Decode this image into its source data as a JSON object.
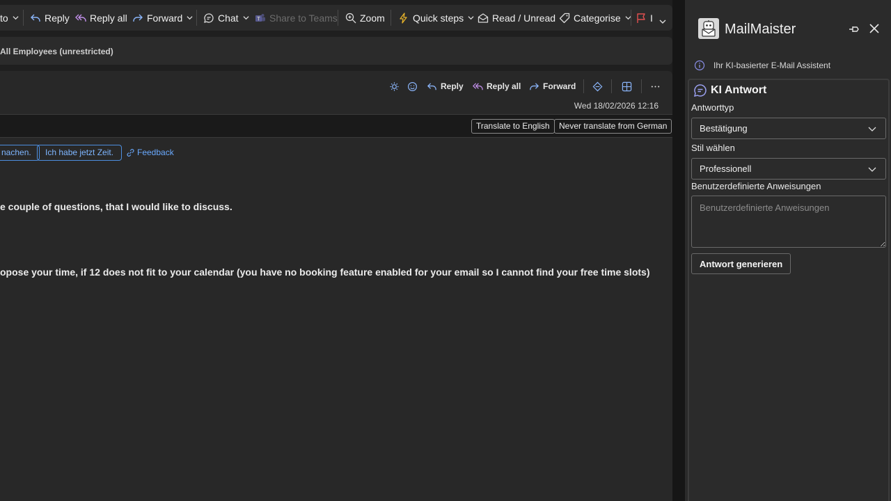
{
  "ribbon": {
    "move_label": "to",
    "reply": "Reply",
    "reply_all": "Reply all",
    "forward": "Forward",
    "chat": "Chat",
    "share_to_teams": "Share to Teams",
    "zoom": "Zoom",
    "quick_steps": "Quick steps",
    "read_unread": "Read / Unread",
    "categorise": "Categorise",
    "flag_label": "I"
  },
  "sensitivity": {
    "label": "All Employees (unrestricted)"
  },
  "message": {
    "toolbar": {
      "reply": "Reply",
      "reply_all": "Reply all",
      "forward": "Forward"
    },
    "date": "Wed 18/02/2026 12:16",
    "translate_button": "Translate to English",
    "never_translate_button": "Never translate from German",
    "suggested_replies": [
      "nachen.",
      "Ich habe jetzt Zeit."
    ],
    "feedback": "Feedback",
    "body": [
      "e couple of questions, that I would like to discuss.",
      "opose your time, if 12 does not fit to your calendar (you have no booking feature enabled for your email so I cannot find your free time slots)"
    ]
  },
  "addin": {
    "title": "MailMaister",
    "subtitle": "Ihr KI-basierter E-Mail Assistent",
    "section_title": "KI Antwort",
    "response_type_label": "Antworttyp",
    "response_type_value": "Bestätigung",
    "style_label": "Stil wählen",
    "style_value": "Professionell",
    "custom_label": "Benutzerdefinierte Anweisungen",
    "custom_placeholder": "Benutzerdefinierte Anweisungen",
    "generate_button": "Antwort generieren"
  },
  "colors": {
    "accent_blue": "#4d8fe0",
    "flag_red": "#e05050",
    "quick_steps_yellow": "#e8b42a",
    "reply_icon": "#8ab4f8",
    "reply_all_icon": "#c08ee8",
    "forward_icon": "#8ab4f8"
  }
}
